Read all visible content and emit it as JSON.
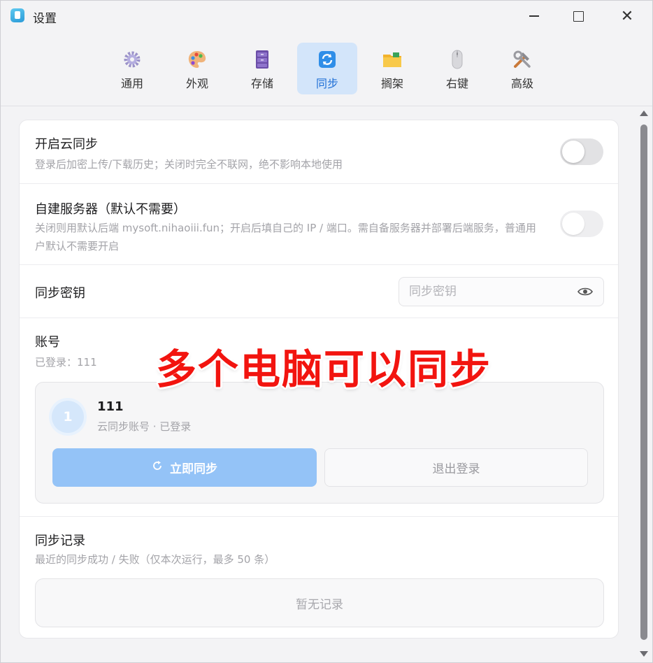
{
  "window": {
    "title": "设置"
  },
  "tabs": [
    {
      "label": "通用",
      "icon": "gear-icon",
      "active": false
    },
    {
      "label": "外观",
      "icon": "palette-icon",
      "active": false
    },
    {
      "label": "存储",
      "icon": "cabinet-icon",
      "active": false
    },
    {
      "label": "同步",
      "icon": "sync-icon",
      "active": true
    },
    {
      "label": "搁架",
      "icon": "folder-icon",
      "active": false
    },
    {
      "label": "右键",
      "icon": "mouse-icon",
      "active": false
    },
    {
      "label": "高级",
      "icon": "tools-icon",
      "active": false
    }
  ],
  "cloud_sync": {
    "title": "开启云同步",
    "desc": "登录后加密上传/下载历史；关闭时完全不联网，绝不影响本地使用",
    "enabled": false
  },
  "self_server": {
    "title": "自建服务器（默认不需要）",
    "desc": "关闭则用默认后端 mysoft.nihaoiii.fun；开启后填自己的 IP / 端口。需自备服务器并部署后端服务，普通用户默认不需要开启",
    "enabled": false
  },
  "sync_key": {
    "title": "同步密钥",
    "placeholder": "同步密钥"
  },
  "account": {
    "title": "账号",
    "status": "已登录：111",
    "avatar_letter": "1",
    "name": "111",
    "sub": "云同步账号 · 已登录",
    "sync_now_label": "立即同步",
    "logout_label": "退出登录"
  },
  "history": {
    "title": "同步记录",
    "desc": "最近的同步成功 / 失败（仅本次运行，最多 50 条）",
    "empty": "暂无记录"
  },
  "overlay_text": "多个电脑可以同步",
  "colors": {
    "accent": "#1f6fd6",
    "active_tab_bg": "#d3e5fa",
    "sync_button": "#94c3f7",
    "overlay_red": "#f2140f"
  }
}
